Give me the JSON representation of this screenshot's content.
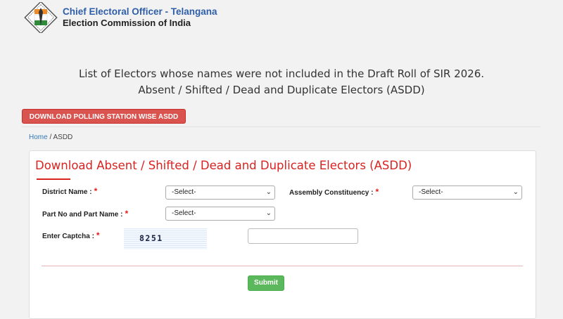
{
  "header": {
    "org_title": "Chief Electoral Officer - Telangana",
    "org_subtitle": "Election Commission of India",
    "logo_icon": "election-commission-logo-icon"
  },
  "page": {
    "heading_line1": "List of Electors whose names were not included in the Draft Roll of SIR 2026.",
    "heading_line2": "Absent / Shifted / Dead and Duplicate Electors (ASDD)"
  },
  "actions": {
    "download_polling_station_label": "DOWNLOAD POLLING STATION WISE ASDD"
  },
  "breadcrumb": {
    "home": "Home",
    "separator": "/",
    "current": "ASDD"
  },
  "form": {
    "title": "Download Absent / Shifted / Dead and Duplicate Electors (ASDD)",
    "required_mark": "*",
    "district": {
      "label": "District Name :",
      "value": "-Select-"
    },
    "assembly": {
      "label": "Assembly Constituency :",
      "value": "-Select-"
    },
    "part": {
      "label": "Part No and Part Name :",
      "value": "-Select-"
    },
    "captcha": {
      "label": "Enter Captcha :",
      "code": "8251",
      "input_value": ""
    },
    "submit_label": "Submit"
  },
  "colors": {
    "accent_red": "#d9231f",
    "download_button": "#d9534f",
    "submit_button": "#5cb85c",
    "org_title": "#2f5ea8"
  }
}
